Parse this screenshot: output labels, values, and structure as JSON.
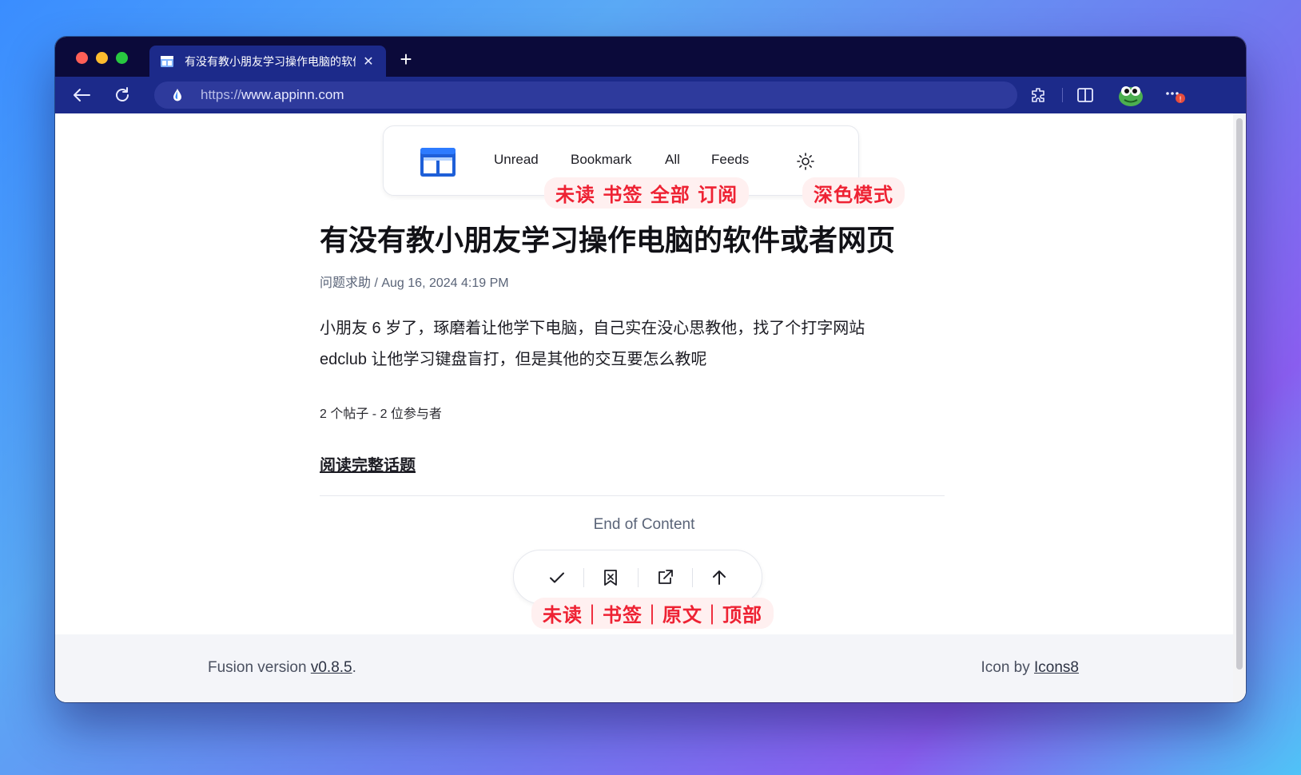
{
  "browser": {
    "tab_title": "有没有教小朋友学习操作电脑的软件或者网页",
    "new_tab_symbol": "+",
    "url_scheme": "https://",
    "url_host": "www.appinn.com"
  },
  "nav": {
    "unread": "Unread",
    "bookmark": "Bookmark",
    "all": "All",
    "feeds": "Feeds",
    "theme_icon": "sun-icon"
  },
  "annotations": {
    "nav_labels": "未读 书签 全部 订阅",
    "theme_label": "深色模式",
    "action_labels": "未读｜书签｜原文｜顶部"
  },
  "article": {
    "title": "有没有教小朋友学习操作电脑的软件或者网页",
    "category": "问题求助",
    "date": "Aug 16, 2024 4:19 PM",
    "body_line1": "小朋友 6 岁了，琢磨着让他学下电脑，自己实在没心思教他，找了个打字网站",
    "body_line2": "edclub 让他学习键盘盲打，但是其他的交互要怎么教呢",
    "stats": "2 个帖子 - 2 位参与者",
    "read_full": "阅读完整话题"
  },
  "end_of_content": "End of Content",
  "footer": {
    "version_prefix": "Fusion version ",
    "version": "v0.8.5",
    "version_suffix": ".",
    "icon_prefix": "Icon by ",
    "icon_link": "Icons8"
  },
  "colors": {
    "accent": "#1c2a8a",
    "annotation": "#ee2233"
  }
}
